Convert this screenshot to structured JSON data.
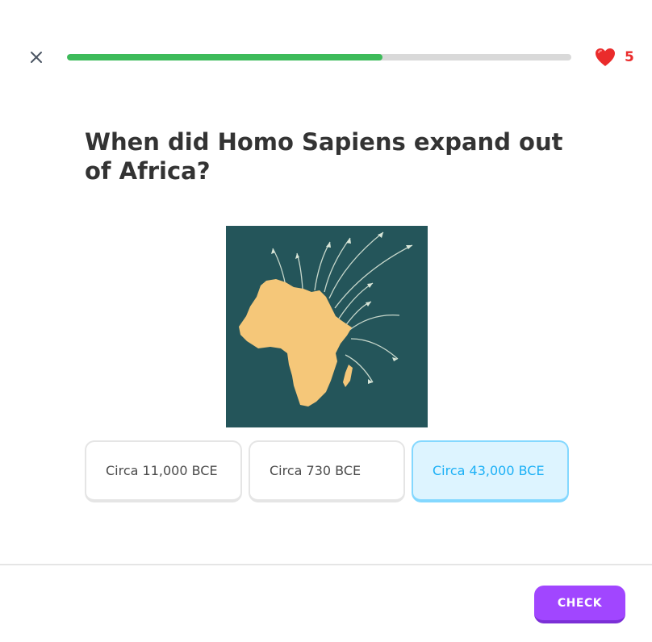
{
  "header": {
    "close_icon": "close-icon",
    "progress": 0.625,
    "lives_icon": "heart-icon",
    "lives_count": "5"
  },
  "question": {
    "text": "When did Homo Sapiens expand out of Africa?"
  },
  "illustration": {
    "description_icon": "africa-migration-map"
  },
  "options": [
    {
      "label": "Circa 11,000 BCE",
      "selected": false
    },
    {
      "label": "Circa 730 BCE",
      "selected": false
    },
    {
      "label": "Circa 43,000 BCE",
      "selected": true
    }
  ],
  "footer": {
    "check_label": "CHECK"
  },
  "colors": {
    "progress": "#3dbb5a",
    "heart": "#ea2b2b",
    "selected_bg": "#ddf4ff",
    "selected_border": "#84d8ff",
    "selected_text": "#1cb0f6",
    "check_button": "#a146ff",
    "map_background": "#24555a",
    "africa": "#f5c779"
  }
}
